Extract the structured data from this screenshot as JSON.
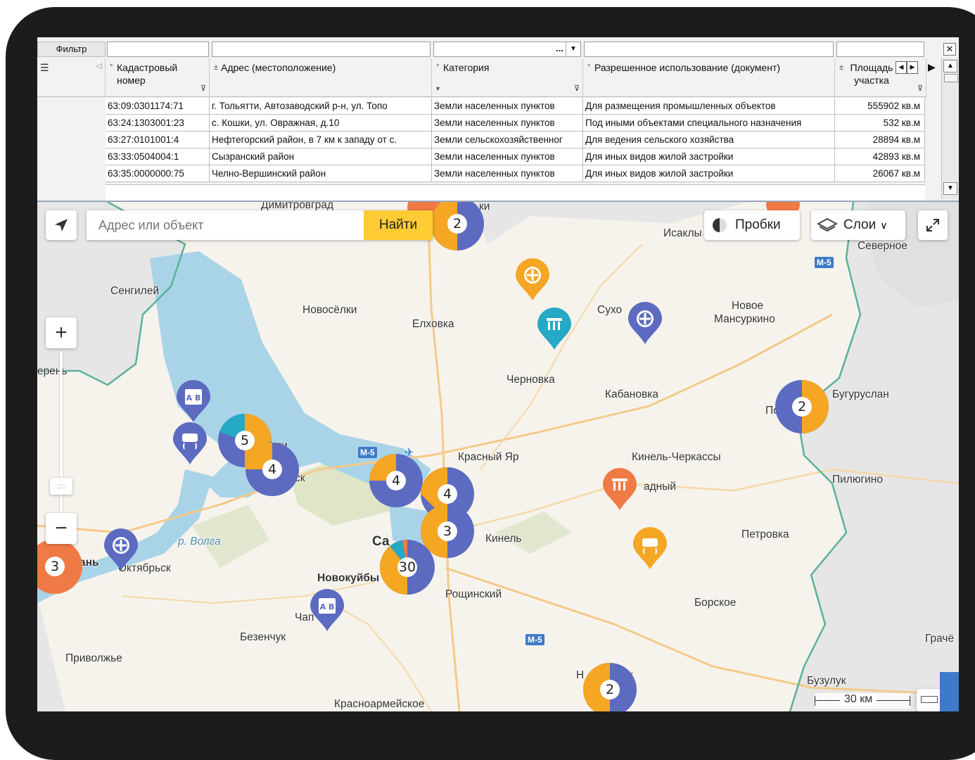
{
  "grid": {
    "filter_label": "Фильтр",
    "category_filter_value": "...",
    "columns": [
      {
        "label": "Кадастровый номер"
      },
      {
        "label": "Адрес (местоположение)"
      },
      {
        "label": "Категория"
      },
      {
        "label": "Разрешенное использование (документ)"
      },
      {
        "label": "Площадь участка"
      }
    ],
    "rows": [
      {
        "cadnum": "63:09:0301174:71",
        "address": "г. Тольятти, Автозаводский р-н, ул. Топо",
        "category": "Земли населенных пунктов",
        "usage": "Для размещения промышленных объектов",
        "area": "555902 кв.м"
      },
      {
        "cadnum": "63:24:1303001:23",
        "address": "с. Кошки, ул. Овражная, д.10",
        "category": "Земли населенных пунктов",
        "usage": "Под иными объектами специального назначения",
        "area": "532 кв.м"
      },
      {
        "cadnum": "63:27:0101001:4",
        "address": "Нефтегорский район, в 7 км к западу от с.",
        "category": "Земли сельскохозяйственног",
        "usage": "Для ведения сельского хозяйства",
        "area": "28894 кв.м"
      },
      {
        "cadnum": "63:33:0504004:1",
        "address": "Сызранский район",
        "category": "Земли населенных пунктов",
        "usage": "Для иных видов жилой застройки",
        "area": "42893 кв.м"
      },
      {
        "cadnum": "63:35:0000000:75",
        "address": "Челно-Вершинский район",
        "category": "Земли населенных пунктов",
        "usage": "Для иных видов жилой застройки",
        "area": "26067 кв.м"
      }
    ]
  },
  "map": {
    "search_placeholder": "Адрес или объект",
    "search_button": "Найти",
    "traffic_button": "Пробки",
    "layers_button": "Слои",
    "scale_label": "30 км",
    "colors": {
      "blue": "#5c6bc0",
      "orange": "#f5a623",
      "teal": "#26a9c4",
      "red": "#f07a45",
      "water": "#a8d3e6",
      "forest": "#d9e4c4"
    },
    "places": [
      {
        "text": "Димитровград"
      },
      {
        "text": "Исаклы"
      },
      {
        "text": "Северное"
      },
      {
        "text": "Сенгилей"
      },
      {
        "text": "Новосёлки"
      },
      {
        "text": "Елховка"
      },
      {
        "text": "Сухо"
      },
      {
        "text": "Новое"
      },
      {
        "text": "Мансуркино"
      },
      {
        "text": "Черновка"
      },
      {
        "text": "Кабановка"
      },
      {
        "text": "Бугуруслан"
      },
      {
        "text": "Красный Яр"
      },
      {
        "text": "Кинель-Черкассы"
      },
      {
        "text": "адный"
      },
      {
        "text": "Пилюгино"
      },
      {
        "text": "Кинель"
      },
      {
        "text": "Петровка"
      },
      {
        "text": "Октябрьск"
      },
      {
        "text": "Новокуйбы"
      },
      {
        "text": "Рощинский"
      },
      {
        "text": "Борское"
      },
      {
        "text": "Безенчук"
      },
      {
        "text": "Приволжье"
      },
      {
        "text": "Чап"
      },
      {
        "text": "Бузулук"
      },
      {
        "text": "Грачё"
      },
      {
        "text": "Красноармейское"
      },
      {
        "text": "р. Волга"
      },
      {
        "text": "ерень"
      },
      {
        "text": "Са"
      },
      {
        "text": "ань"
      },
      {
        "text": "По"
      },
      {
        "text": "Н"
      },
      {
        "text": "ск"
      },
      {
        "text": "ск"
      },
      {
        "text": "ки"
      },
      {
        "text": "ти"
      }
    ],
    "road_badges": [
      "M-5",
      "M-5",
      "M-5"
    ],
    "clusters": [
      {
        "count": "2"
      },
      {
        "count": "5"
      },
      {
        "count": "4"
      },
      {
        "count": "4"
      },
      {
        "count": "4"
      },
      {
        "count": "3"
      },
      {
        "count": "30"
      },
      {
        "count": "3"
      },
      {
        "count": "2"
      },
      {
        "count": "2"
      }
    ]
  }
}
